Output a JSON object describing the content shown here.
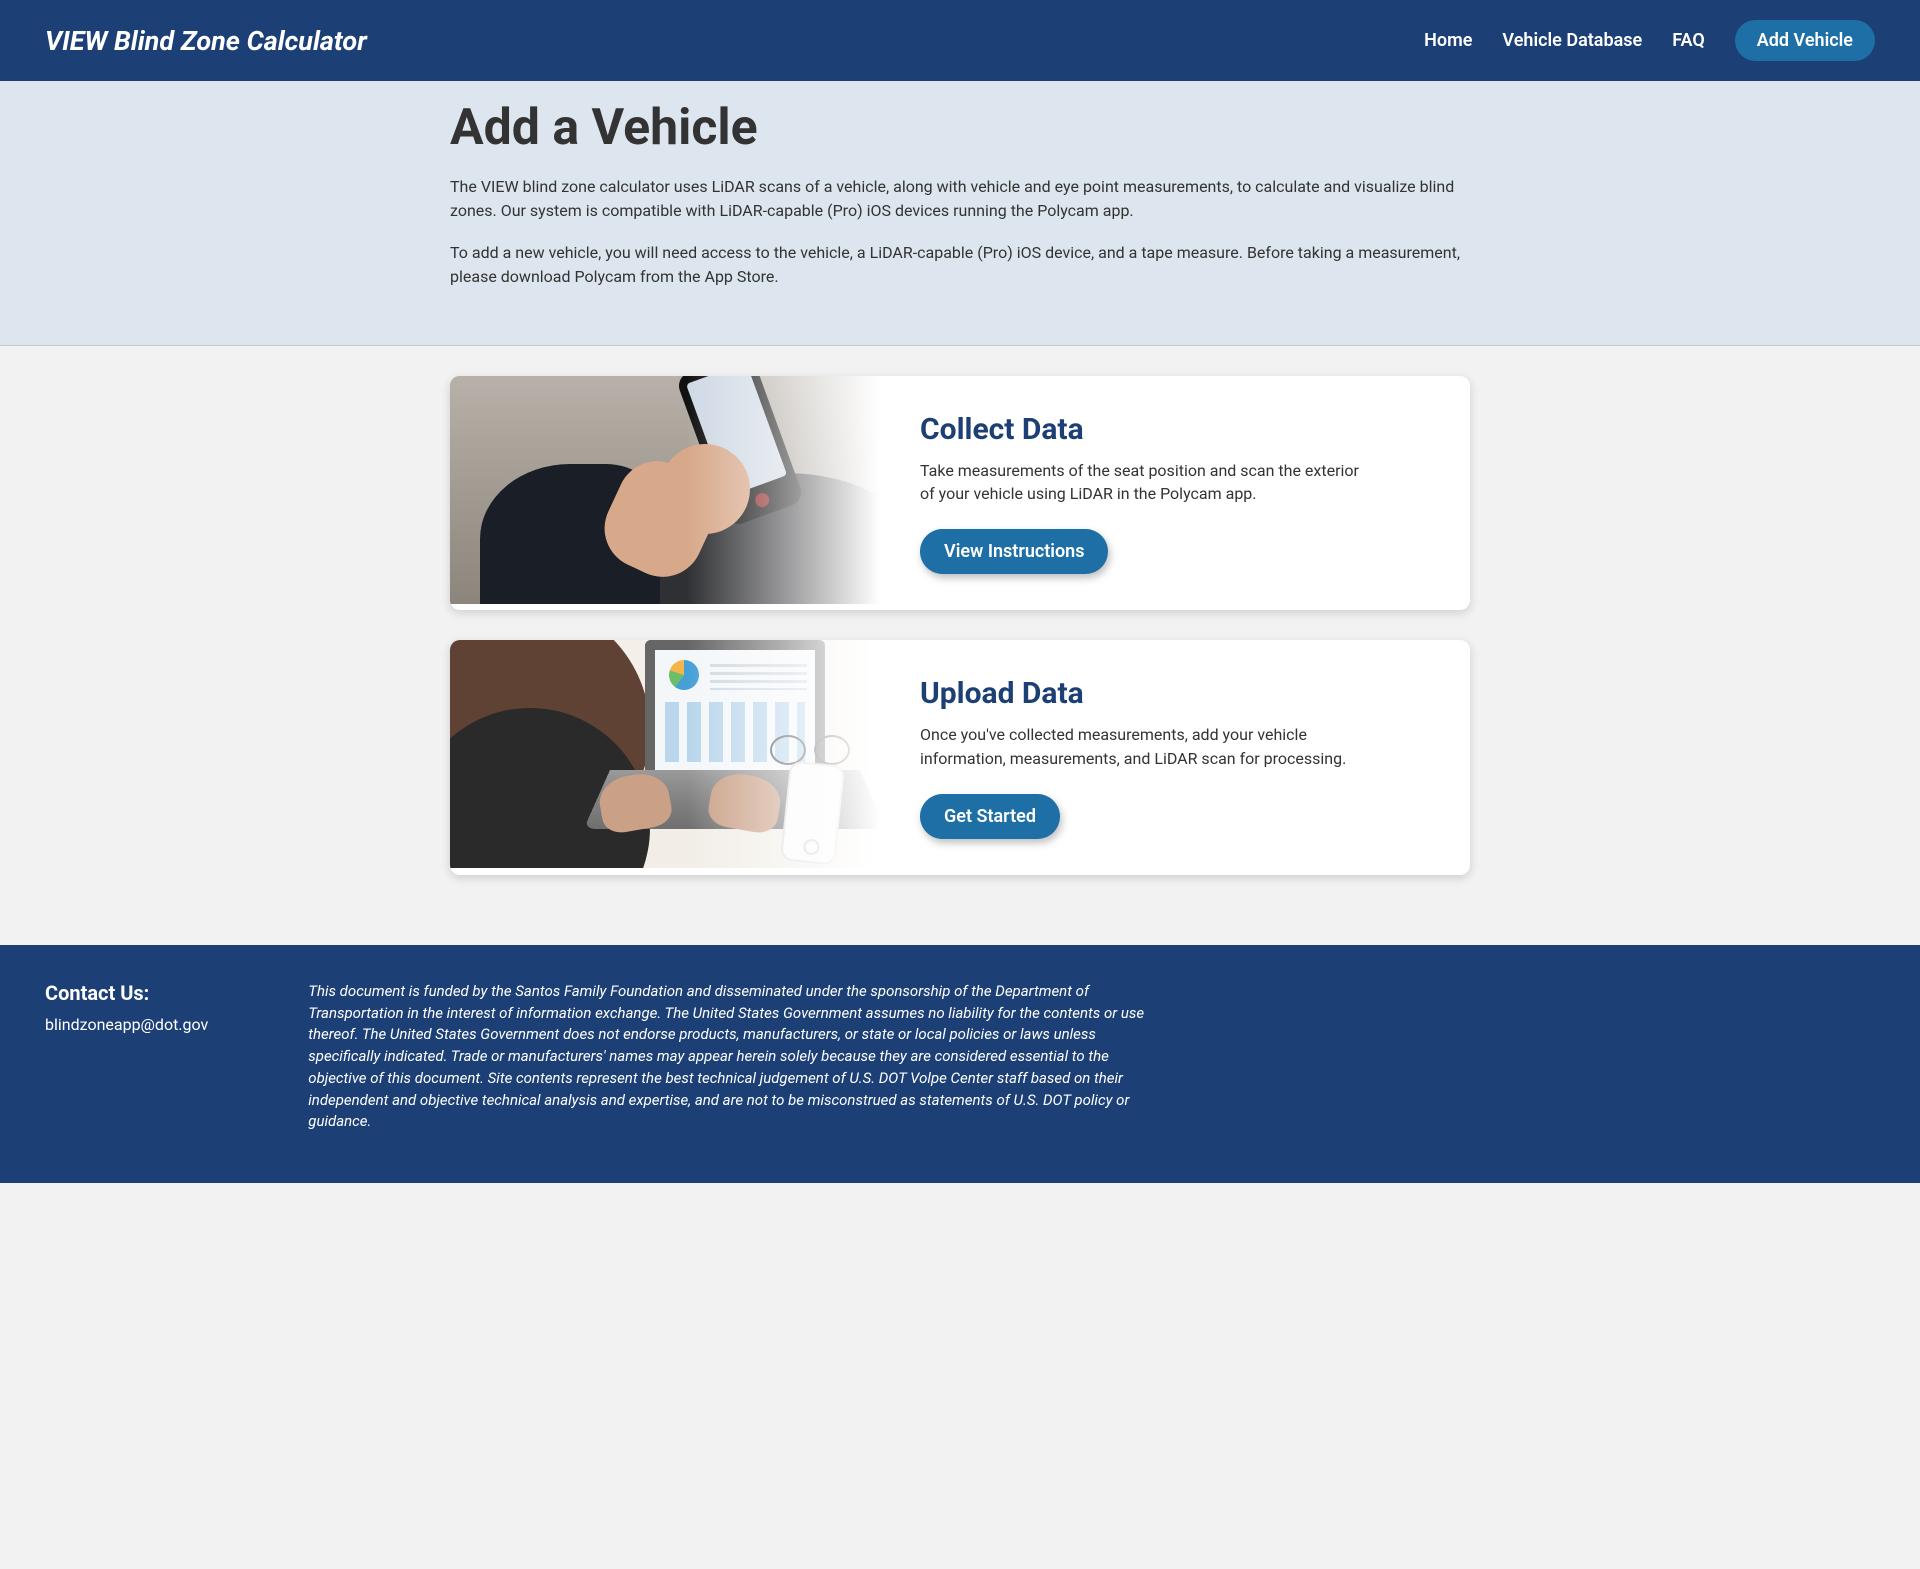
{
  "nav": {
    "brand": "VIEW Blind Zone Calculator",
    "links": [
      "Home",
      "Vehicle Database",
      "FAQ"
    ],
    "cta": "Add Vehicle"
  },
  "hero": {
    "title": "Add a Vehicle",
    "p1": "The VIEW blind zone calculator uses LiDAR scans of a vehicle, along with vehicle and eye point measurements, to calculate and visualize blind zones. Our system is compatible with LiDAR-capable (Pro) iOS devices running the Polycam app.",
    "p2": "To add a new vehicle, you will need access to the vehicle, a LiDAR-capable (Pro) iOS device, and a tape measure. Before taking a measurement, please download Polycam from the App Store."
  },
  "cards": {
    "collect": {
      "title": "Collect Data",
      "text": "Take measurements of the seat position and scan the exterior of your vehicle using LiDAR in the Polycam app.",
      "button": "View Instructions"
    },
    "upload": {
      "title": "Upload Data",
      "text": "Once you've collected measurements, add your vehicle information, measurements, and LiDAR scan for processing.",
      "button": "Get Started"
    }
  },
  "footer": {
    "contact_heading": "Contact Us:",
    "email": "blindzoneapp@dot.gov",
    "disclaimer": "This document is funded by the Santos Family Foundation and disseminated under the sponsorship of the Department of Transportation in the interest of information exchange. The United States Government assumes no liability for the contents or use thereof. The United States Government does not endorse products, manufacturers, or state or local policies or laws unless specifically indicated. Trade or manufacturers' names may appear herein solely because they are considered essential to the objective of this document. Site contents represent the best technical judgement of U.S. DOT Volpe Center staff based on their independent and objective technical analysis and expertise, and are not to be misconstrued as statements of U.S. DOT policy or guidance."
  }
}
